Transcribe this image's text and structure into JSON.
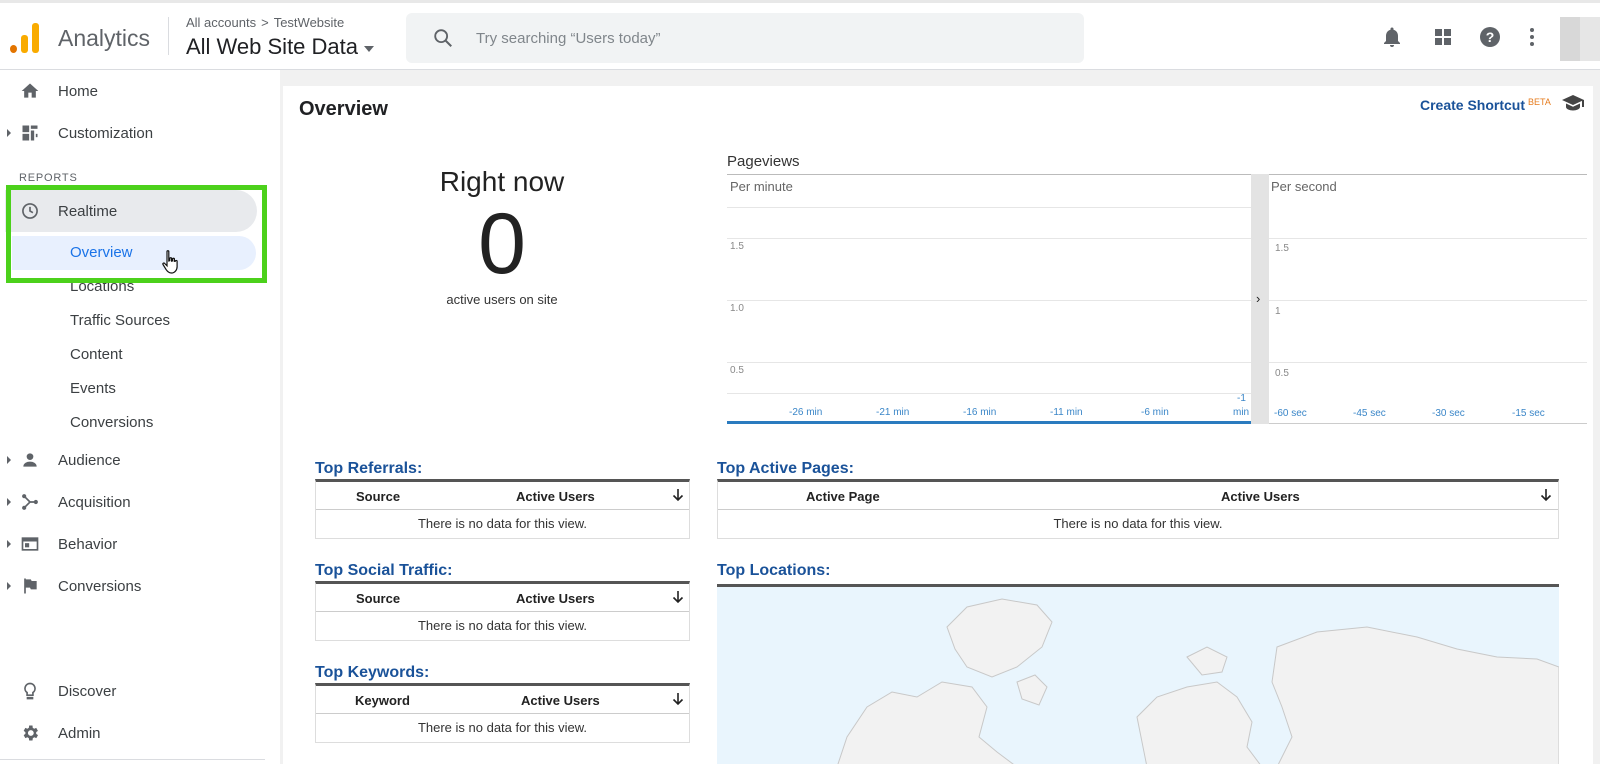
{
  "header": {
    "app_name": "Analytics",
    "breadcrumb": [
      "All accounts",
      "TestWebsite"
    ],
    "breadcrumb_separator": ">",
    "property_name": "All Web Site Data",
    "search_placeholder": "Try searching “Users today”",
    "icons": [
      "bell-icon",
      "apps-grid-icon",
      "help-icon",
      "more-vert-icon"
    ],
    "logo_colors": [
      "#e37400",
      "#f9ab00",
      "#f9ab00"
    ]
  },
  "sidebar": {
    "top_items": [
      {
        "label": "Home",
        "icon": "home-icon",
        "expandable": false
      },
      {
        "label": "Customization",
        "icon": "dashboard-icon",
        "expandable": true
      }
    ],
    "section_label": "REPORTS",
    "realtime": {
      "label": "Realtime",
      "icon": "clock-icon",
      "sub_items": [
        "Overview",
        "Locations",
        "Traffic Sources",
        "Content",
        "Events",
        "Conversions"
      ],
      "active_sub": "Overview"
    },
    "report_items": [
      {
        "label": "Audience",
        "icon": "person-icon"
      },
      {
        "label": "Acquisition",
        "icon": "acquisition-icon"
      },
      {
        "label": "Behavior",
        "icon": "behavior-icon"
      },
      {
        "label": "Conversions",
        "icon": "flag-icon"
      }
    ],
    "bottom_items": [
      {
        "label": "Discover",
        "icon": "lightbulb-icon"
      },
      {
        "label": "Admin",
        "icon": "gear-icon"
      }
    ],
    "highlight_color": "#4cd11b"
  },
  "main": {
    "title": "Overview",
    "create_shortcut": "Create Shortcut",
    "beta": "BETA",
    "right_now": {
      "title": "Right now",
      "count": "0",
      "subtitle": "active users on site"
    },
    "pageviews": {
      "title": "Pageviews",
      "per_minute": {
        "label": "Per minute",
        "y_ticks": [
          "1.5",
          "1.0",
          "0.5"
        ],
        "x_ticks": [
          "-26 min",
          "-21 min",
          "-16 min",
          "-11 min",
          "-6 min"
        ],
        "last_tick_top": "-1",
        "last_tick_bottom": "min"
      },
      "per_second": {
        "label": "Per second",
        "y_ticks": [
          "1.5",
          "1",
          "0.5"
        ],
        "x_ticks": [
          "-60 sec",
          "-45 sec",
          "-30 sec",
          "-15 sec"
        ]
      },
      "expand_chevron": "›"
    },
    "tables": {
      "top_referrals": {
        "title": "Top Referrals:",
        "col1": "Source",
        "col2": "Active Users",
        "empty": "There is no data for this view."
      },
      "top_social": {
        "title": "Top Social Traffic:",
        "col1": "Source",
        "col2": "Active Users",
        "empty": "There is no data for this view."
      },
      "top_keywords": {
        "title": "Top Keywords:",
        "col1": "Keyword",
        "col2": "Active Users",
        "empty": "There is no data for this view."
      },
      "top_pages": {
        "title": "Top Active Pages:",
        "col1": "Active Page",
        "col2": "Active Users",
        "empty": "There is no data for this view."
      },
      "top_locations": {
        "title": "Top Locations:"
      }
    },
    "accent_color": "#1a5299"
  }
}
